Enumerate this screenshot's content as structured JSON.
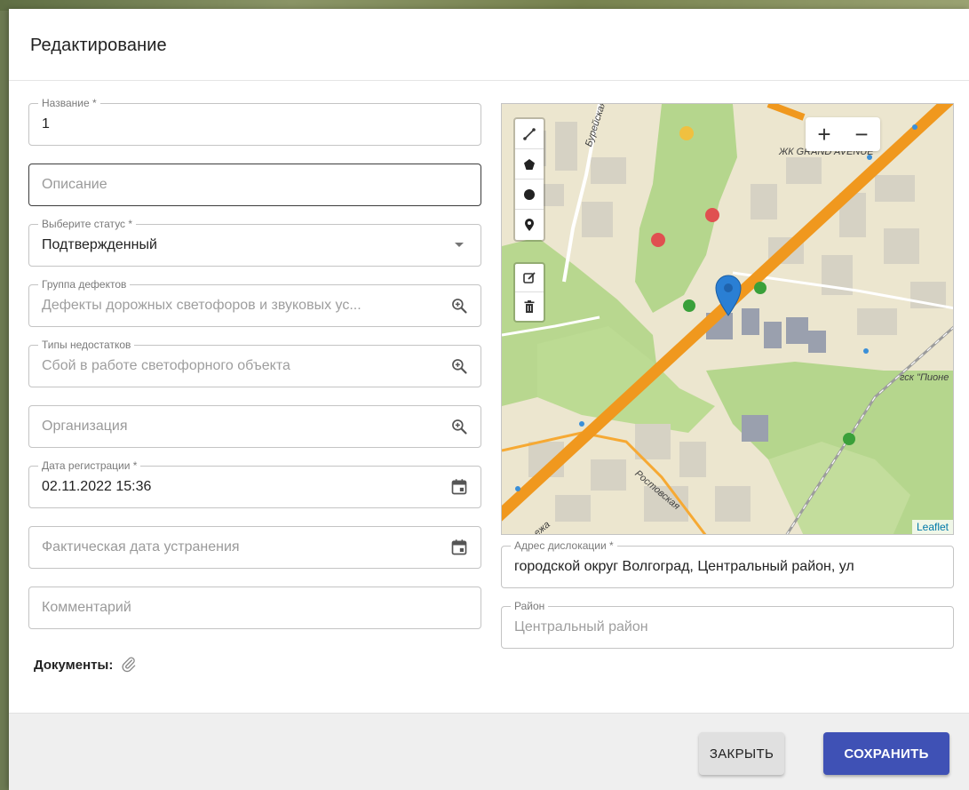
{
  "dialog": {
    "title": "Редактирование"
  },
  "form": {
    "name": {
      "label": "Название *",
      "value": "1"
    },
    "description": {
      "placeholder": "Описание"
    },
    "status": {
      "label": "Выберите статус *",
      "value": "Подтвержденный"
    },
    "defect_group": {
      "label": "Группа дефектов",
      "value": "Дефекты дорожных светофоров и звуковых ус..."
    },
    "defect_types": {
      "label": "Типы недостатков",
      "value": "Сбой в работе светофорного объекта"
    },
    "organization": {
      "placeholder": "Организация"
    },
    "registration_date": {
      "label": "Дата регистрации *",
      "value": "02.11.2022 15:36"
    },
    "actual_fix_date": {
      "placeholder": "Фактическая дата устранения"
    },
    "comment": {
      "placeholder": "Комментарий"
    },
    "address": {
      "label": "Адрес дислокации *",
      "value": "городской округ Волгоград, Центральный район, ул"
    },
    "district": {
      "label": "Район",
      "value": "Центральный район"
    }
  },
  "documents": {
    "label": "Документы:"
  },
  "map": {
    "zoom_in": "+",
    "zoom_out": "−",
    "attribution": "Leaflet",
    "labels": {
      "bureyskaya": "Бурейская",
      "grand_avenue": "ЖК GRAND AVENUE",
      "rostovskaya": "Ростовская",
      "gsk": "гск \"Пионе",
      "street_fragment": "ежа"
    },
    "colors": {
      "highway": "#f0981e",
      "park": "#b5d68d",
      "marker": "#2a7fd4"
    }
  },
  "buttons": {
    "close": "ЗАКРЫТЬ",
    "save": "СОХРАНИТЬ"
  },
  "colors": {
    "primary": "#3f51b5"
  }
}
